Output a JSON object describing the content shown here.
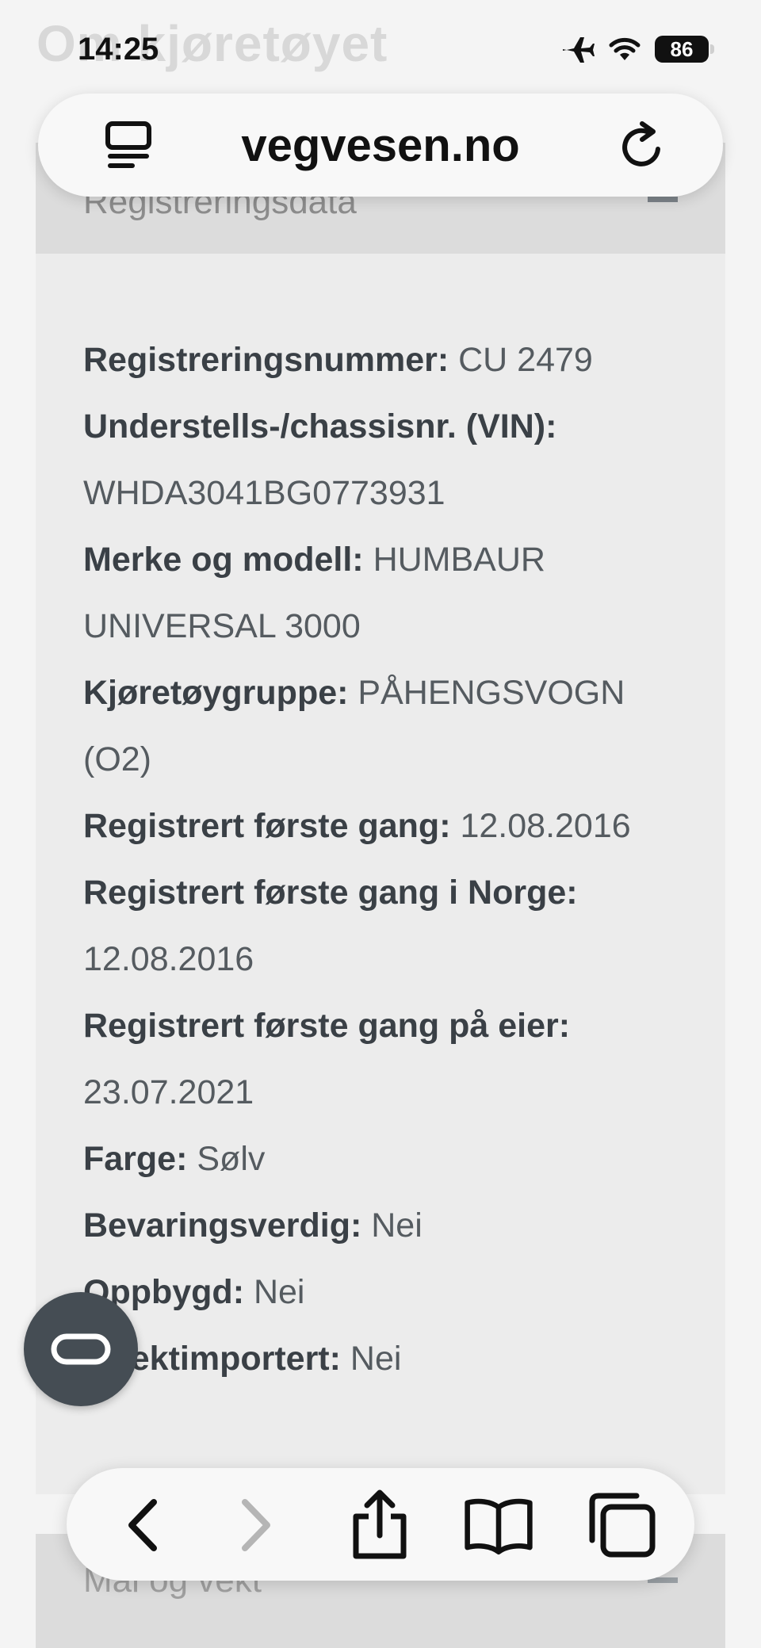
{
  "page": {
    "heading": "Om kjøretøyet"
  },
  "status_bar": {
    "time": "14:25",
    "battery": "86"
  },
  "address_bar": {
    "domain": "vegvesen.no"
  },
  "section": {
    "title": "Registreringsdata",
    "fields": [
      {
        "label": "Registreringsnummer:",
        "value": "CU 2479"
      },
      {
        "label": "Understells-/chassisnr. (VIN):",
        "value": "WHDA3041BG0773931"
      },
      {
        "label": "Merke og modell:",
        "value": "HUMBAUR UNIVERSAL 3000"
      },
      {
        "label": "Kjøretøygruppe:",
        "value": "PÅHENGSVOGN (O2)"
      },
      {
        "label": "Registrert første gang:",
        "value": "12.08.2016"
      },
      {
        "label": "Registrert første gang i Norge:",
        "value": "12.08.2016"
      },
      {
        "label": "Registrert første gang på eier:",
        "value": "23.07.2021"
      },
      {
        "label": "Farge:",
        "value": "Sølv"
      },
      {
        "label": "Bevaringsverdig:",
        "value": "Nei"
      },
      {
        "label": "Oppbygd:",
        "value": "Nei"
      },
      {
        "label": "Direktimportert:",
        "value": "Nei"
      }
    ]
  },
  "next_section": {
    "title": "Mål og vekt"
  },
  "icons": {
    "reader": "reader-mode-icon",
    "reload": "reload-icon",
    "fab": "link-icon",
    "back": "back-icon",
    "forward": "forward-icon",
    "share": "share-icon",
    "bookmarks": "bookmarks-icon",
    "tabs": "tabs-icon"
  }
}
